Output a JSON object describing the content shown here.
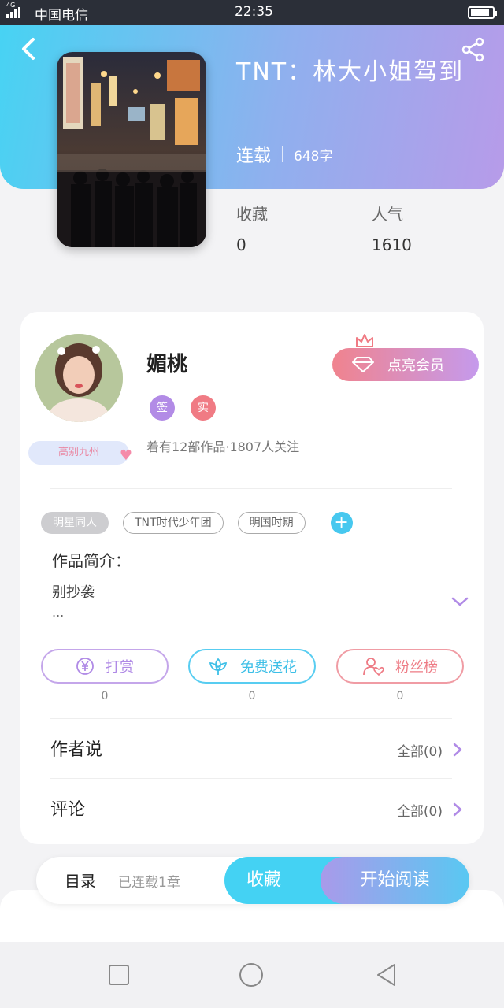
{
  "status_bar": {
    "network": "4G",
    "carrier": "中国电信",
    "time": "22:35",
    "battery_level": 0.9
  },
  "header": {
    "back_icon": "chevron-left-icon",
    "share_icon": "share-icon"
  },
  "book": {
    "title": "TNT：林大小姐驾到",
    "status": "连载",
    "word_count": "648字",
    "stats": [
      {
        "label": "收藏",
        "value": "0"
      },
      {
        "label": "人气",
        "value": "1610"
      }
    ]
  },
  "author": {
    "name": "媚桃",
    "badges": [
      "签",
      "实"
    ],
    "stats": "着有12部作品·1807人关注",
    "frame_badge": "高别九州",
    "vip_button": "点亮会员"
  },
  "tags": [
    "明星同人",
    "TNT时代少年团",
    "明国时期"
  ],
  "intro": {
    "title": "作品简介：",
    "text": "别抄袭",
    "ellipsis": "..."
  },
  "actions": [
    {
      "label": "打赏",
      "icon": "yuan-icon",
      "count": "0"
    },
    {
      "label": "免费送花",
      "icon": "flower-icon",
      "count": "0"
    },
    {
      "label": "粉丝榜",
      "icon": "fan-rank-icon",
      "count": "0"
    }
  ],
  "rows": [
    {
      "label": "作者说",
      "value": "全部(0)"
    },
    {
      "label": "评论",
      "value": "全部(0)"
    }
  ],
  "bottom_bar": {
    "toc_label": "目录",
    "toc_status": "已连载1章",
    "collect_label": "收藏",
    "read_label": "开始阅读"
  },
  "colors": {
    "header_start": "#47d3f3",
    "header_end": "#b79be9",
    "accent_blue": "#44d2f3",
    "accent_purple": "#b08ae6",
    "accent_red": "#ee7a84"
  }
}
